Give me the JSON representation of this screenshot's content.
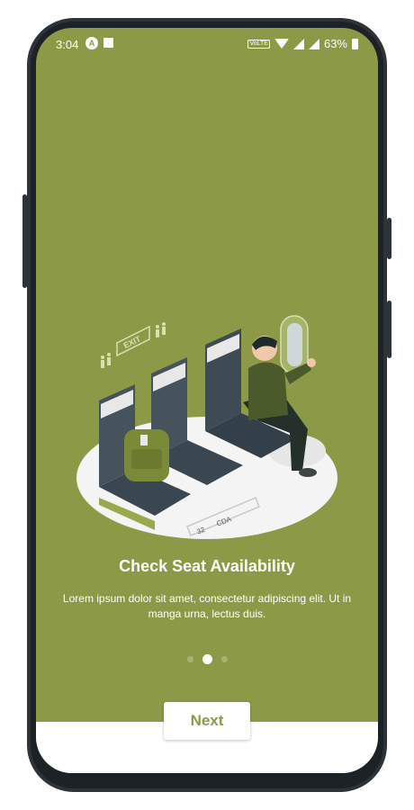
{
  "status_bar": {
    "time": "3:04",
    "battery": "63%",
    "volte": "VoLTE",
    "app_icon": "A"
  },
  "onboarding": {
    "title": "Check Seat Availability",
    "description": "Lorem ipsum dolor sit amet, consectetur adipiscing elit. Ut in manga urna, lectus duis.",
    "illustration": {
      "exit_sign": "EXIT",
      "seat_row": "32",
      "seat_letters": "CDA"
    },
    "page_indicator": {
      "count": 3,
      "active_index": 1
    },
    "next_button": "Next"
  },
  "colors": {
    "accent": "#8c9a48",
    "white": "#ffffff",
    "frame": "#2d3338"
  }
}
